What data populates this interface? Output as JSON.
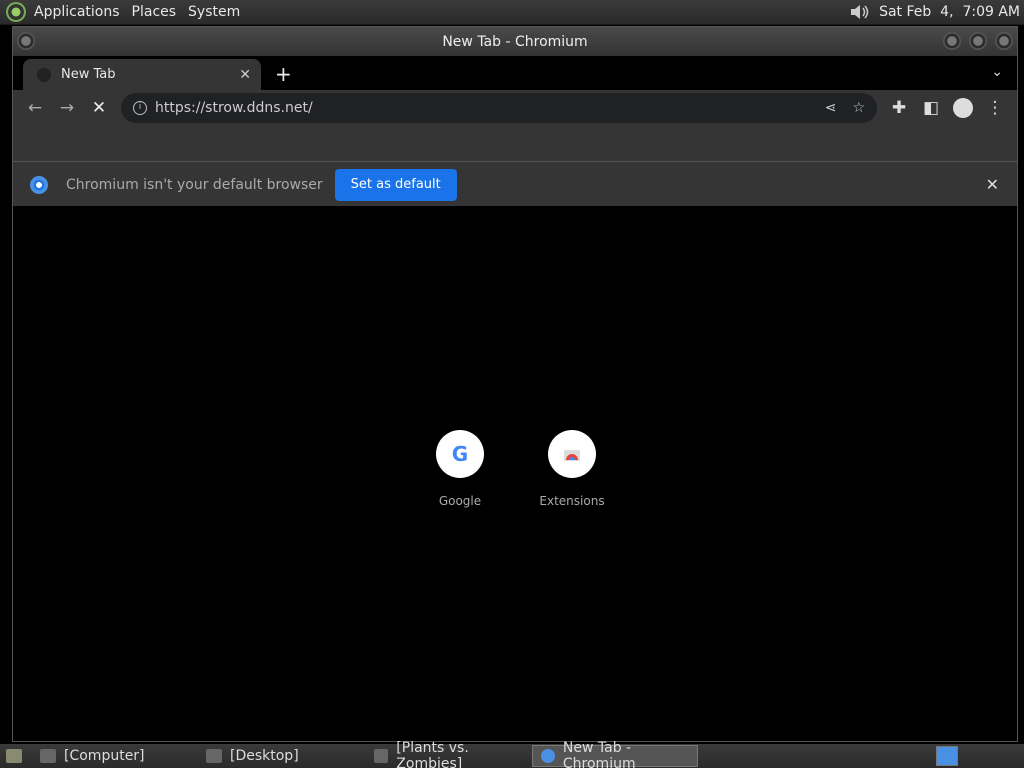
{
  "top_panel": {
    "menus": [
      "Applications",
      "Places",
      "System"
    ],
    "clock": "Sat Feb  4,  7:09 AM"
  },
  "window": {
    "title": "New Tab - Chromium"
  },
  "tab": {
    "title": "New Tab"
  },
  "omnibox": {
    "url": "https://strow.ddns.net/"
  },
  "infobar": {
    "message": "Chromium isn't your default browser",
    "button": "Set as default"
  },
  "shortcuts": [
    {
      "label": "Google"
    },
    {
      "label": "Extensions"
    }
  ],
  "taskbar": {
    "items": [
      "[Computer]",
      "[Desktop]",
      "[Plants vs. Zombies]",
      "New Tab - Chromium"
    ]
  }
}
